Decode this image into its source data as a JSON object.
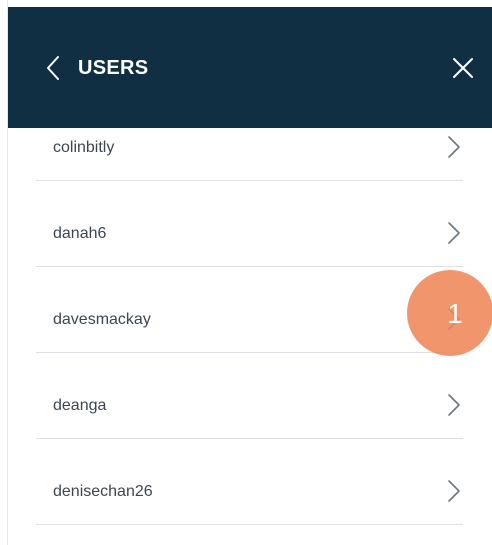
{
  "header": {
    "title": "USERS",
    "back_icon": "chevron-left-icon",
    "close_icon": "close-icon",
    "background": "#112f43"
  },
  "users": [
    {
      "name": "colinbitly"
    },
    {
      "name": "danah6"
    },
    {
      "name": "davesmackay"
    },
    {
      "name": "deanga"
    },
    {
      "name": "denisechan26"
    }
  ],
  "callout": {
    "number": "1",
    "color": "#ef8658"
  }
}
